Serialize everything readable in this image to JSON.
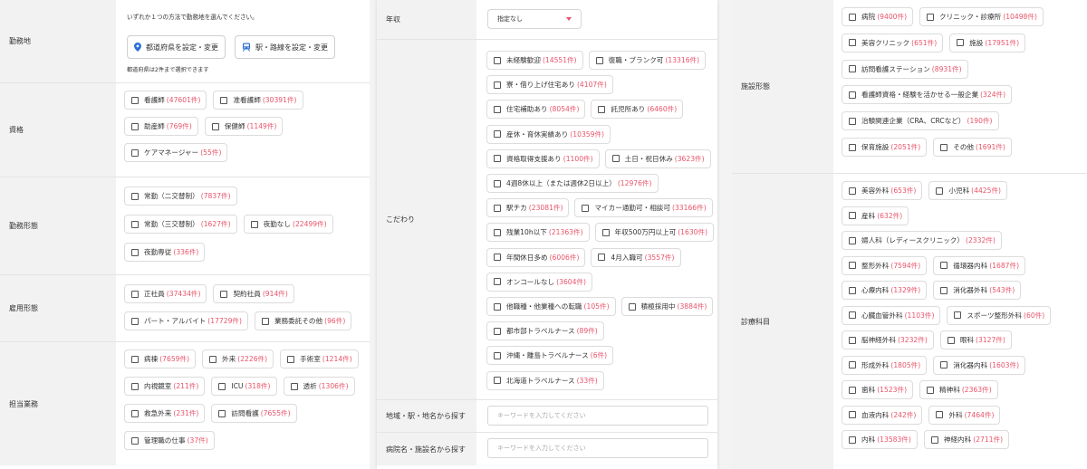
{
  "colors": {
    "accent": "#e8546a",
    "link_icon": "#2b6fd6",
    "label_bg": "#f2f2f2"
  },
  "work_location": {
    "label": "勤務地",
    "hint": "いずれか１つの方法で勤務地を選んでください。",
    "pref_button": "都道府県を設定・変更",
    "pref_icon": "map-pin-icon",
    "station_button": "駅・路線を設定・変更",
    "station_icon": "train-icon",
    "note": "都道府県は2件まで選択できます"
  },
  "license": {
    "label": "資格",
    "options": [
      {
        "name": "看護師",
        "count": "(47601件)"
      },
      {
        "name": "准看護師",
        "count": "(30391件)"
      },
      {
        "name": "助産師",
        "count": "(769件)"
      },
      {
        "name": "保健師",
        "count": "(1149件)"
      },
      {
        "name": "ケアマネージャー",
        "count": "(55件)"
      }
    ]
  },
  "work_style": {
    "label": "勤務形態",
    "options": [
      {
        "name": "常勤（二交替制）",
        "count": "(7837件)"
      },
      {
        "name": "常勤（三交替制）",
        "count": "(1627件)"
      },
      {
        "name": "夜勤なし",
        "count": "(22499件)"
      },
      {
        "name": "夜勤専従",
        "count": "(336件)"
      }
    ]
  },
  "employment": {
    "label": "雇用形態",
    "options": [
      {
        "name": "正社員",
        "count": "(37434件)"
      },
      {
        "name": "契約社員",
        "count": "(914件)"
      },
      {
        "name": "パート・アルバイト",
        "count": "(17729件)"
      },
      {
        "name": "業務委託その他",
        "count": "(96件)"
      }
    ]
  },
  "duties": {
    "label": "担当業務",
    "options": [
      {
        "name": "病棟",
        "count": "(7659件)"
      },
      {
        "name": "外来",
        "count": "(2226件)"
      },
      {
        "name": "手術室",
        "count": "(1214件)"
      },
      {
        "name": "内視鏡室",
        "count": "(211件)"
      },
      {
        "name": "ICU",
        "count": "(318件)"
      },
      {
        "name": "透析",
        "count": "(1306件)"
      },
      {
        "name": "救急外来",
        "count": "(231件)"
      },
      {
        "name": "訪問看護",
        "count": "(7655件)"
      },
      {
        "name": "管理職の仕事",
        "count": "(37件)"
      }
    ]
  },
  "salary": {
    "label": "年収",
    "selected": "指定なし"
  },
  "preferences": {
    "label": "こだわり",
    "options": [
      {
        "name": "未経験歓迎",
        "count": "(14551件)"
      },
      {
        "name": "復職・ブランク可",
        "count": "(13316件)"
      },
      {
        "name": "寮・借り上げ住宅あり",
        "count": "(4107件)"
      },
      {
        "name": "住宅補助あり",
        "count": "(8054件)"
      },
      {
        "name": "託児所あり",
        "count": "(6460件)"
      },
      {
        "name": "産休・育休実績あり",
        "count": "(10359件)"
      },
      {
        "name": "資格取得支援あり",
        "count": "(1100件)"
      },
      {
        "name": "土日・祝日休み",
        "count": "(3623件)"
      },
      {
        "name": "4週8休以上（または週休2日以上）",
        "count": "(12976件)"
      },
      {
        "name": "駅チカ",
        "count": "(23081件)"
      },
      {
        "name": "マイカー通勤可・相談可",
        "count": "(33166件)"
      },
      {
        "name": "残業10h以下",
        "count": "(21363件)"
      },
      {
        "name": "年収500万円以上可",
        "count": "(1630件)"
      },
      {
        "name": "年間休日多め",
        "count": "(6006件)"
      },
      {
        "name": "4月入職可",
        "count": "(3557件)"
      },
      {
        "name": "オンコールなし",
        "count": "(3604件)"
      },
      {
        "name": "他職種・他業種への転職",
        "count": "(105件)"
      },
      {
        "name": "積極採用中",
        "count": "(3884件)"
      },
      {
        "name": "都市部トラベルナース",
        "count": "(89件)"
      },
      {
        "name": "沖縄・離島トラベルナース",
        "count": "(6件)"
      },
      {
        "name": "北海道トラベルナース",
        "count": "(33件)"
      }
    ]
  },
  "area_search": {
    "label": "地域・駅・地名から探す",
    "placeholder": "キーワードを入力してください"
  },
  "facility_search": {
    "label": "病院名・施設名から探す",
    "placeholder": "キーワードを入力してください"
  },
  "facility_type": {
    "label": "施設形態",
    "options": [
      {
        "name": "病院",
        "count": "(9400件)"
      },
      {
        "name": "クリニック・診療所",
        "count": "(10498件)"
      },
      {
        "name": "美容クリニック",
        "count": "(651件)"
      },
      {
        "name": "施設",
        "count": "(17951件)"
      },
      {
        "name": "訪問看護ステーション",
        "count": "(8931件)"
      },
      {
        "name": "看護師資格・経験を活かせる一般企業",
        "count": "(324件)"
      },
      {
        "name": "治験関連企業（CRA、CRCなど）",
        "count": "(190件)"
      },
      {
        "name": "保育施設",
        "count": "(2051件)"
      },
      {
        "name": "その他",
        "count": "(1691件)"
      }
    ]
  },
  "department": {
    "label": "診療科目",
    "options": [
      {
        "name": "美容外科",
        "count": "(653件)"
      },
      {
        "name": "小児科",
        "count": "(4425件)"
      },
      {
        "name": "産科",
        "count": "(632件)"
      },
      {
        "name": "婦人科（レディースクリニック）",
        "count": "(2332件)"
      },
      {
        "name": "整形外科",
        "count": "(7594件)"
      },
      {
        "name": "循環器内科",
        "count": "(1687件)"
      },
      {
        "name": "心療内科",
        "count": "(1329件)"
      },
      {
        "name": "消化器外科",
        "count": "(543件)"
      },
      {
        "name": "心臓血管外科",
        "count": "(1103件)"
      },
      {
        "name": "スポーツ整形外科",
        "count": "(60件)"
      },
      {
        "name": "脳神経外科",
        "count": "(3232件)"
      },
      {
        "name": "眼科",
        "count": "(3127件)"
      },
      {
        "name": "形成外科",
        "count": "(1805件)"
      },
      {
        "name": "消化器内科",
        "count": "(1603件)"
      },
      {
        "name": "歯科",
        "count": "(1523件)"
      },
      {
        "name": "精神科",
        "count": "(2363件)"
      },
      {
        "name": "血液内科",
        "count": "(242件)"
      },
      {
        "name": "外科",
        "count": "(7464件)"
      },
      {
        "name": "内科",
        "count": "(13583件)"
      },
      {
        "name": "神経内科",
        "count": "(2711件)"
      }
    ]
  }
}
